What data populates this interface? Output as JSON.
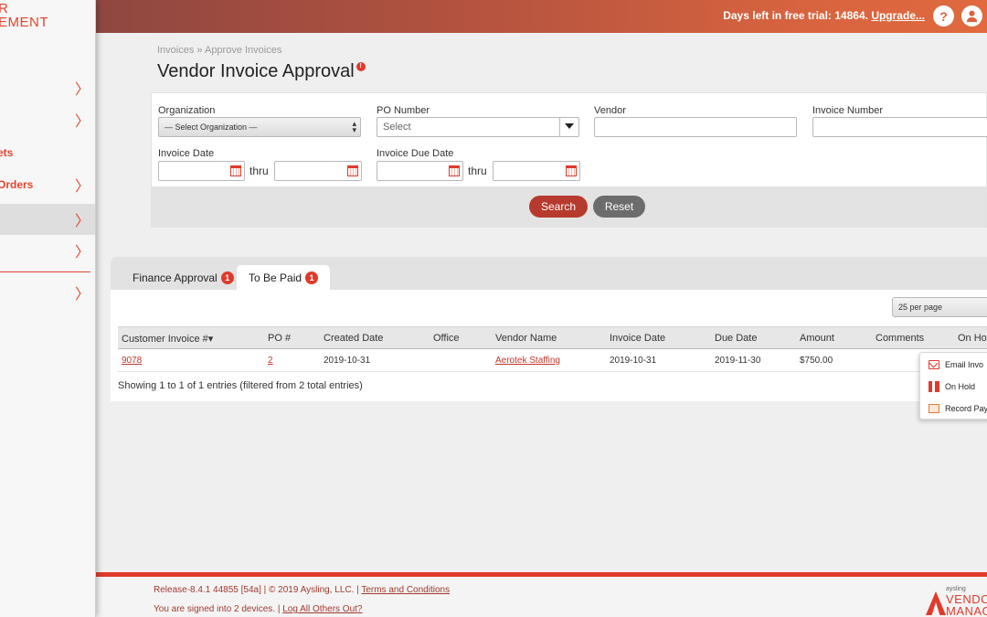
{
  "sidebar": {
    "logo_line1": "R",
    "logo_line2": "EMENT",
    "items": [
      {
        "label": "",
        "chevron": "〉"
      },
      {
        "label": "",
        "chevron": "〉"
      },
      {
        "label": "ets",
        "chevron": ""
      },
      {
        "label": "Orders",
        "chevron": "〉"
      },
      {
        "label": "",
        "chevron": "〉"
      },
      {
        "label": "",
        "chevron": "〉"
      },
      {
        "label": "",
        "chevron": "〉"
      }
    ]
  },
  "header": {
    "trial_text": "Days left in free trial: 14864.",
    "upgrade_label": "Upgrade...",
    "help_icon": "?",
    "user_icon": "user-icon"
  },
  "breadcrumb": "Invoices » Approve Invoices",
  "page_title": "Vendor Invoice Approval",
  "title_info_icon": "!",
  "filters": {
    "organization_label": "Organization",
    "organization_value": "— Select Organization —",
    "po_label": "PO Number",
    "po_placeholder": "Select",
    "vendor_label": "Vendor",
    "invoice_number_label": "Invoice Number",
    "invoice_date_label": "Invoice Date",
    "invoice_due_date_label": "Invoice Due Date",
    "thru_label": "thru",
    "search_label": "Search",
    "reset_label": "Reset"
  },
  "tabs": [
    {
      "label": "Finance Approval",
      "badge": "1"
    },
    {
      "label": "To Be Paid",
      "badge": "1"
    }
  ],
  "per_page": "25 per page",
  "table": {
    "headers": [
      "Customer Invoice #▾",
      "PO #",
      "Created Date",
      "Office",
      "Vendor Name",
      "Invoice Date",
      "Due Date",
      "Amount",
      "Comments",
      "On Hol"
    ],
    "rows": [
      {
        "invoice": "9078",
        "po": "2",
        "created": "2019-10-31",
        "office": "",
        "vendor": "Aerotek Staffing",
        "invoice_date": "2019-10-31",
        "due_date": "2019-11-30",
        "amount": "$750.00",
        "comments": ""
      }
    ],
    "showing": "Showing 1 to 1 of 1 entries (filtered from 2 total entries)"
  },
  "action_menu": [
    {
      "label": "Email Invo",
      "icon": "email-icon"
    },
    {
      "label": "On Hold",
      "icon": "pause-icon"
    },
    {
      "label": "Record Pay",
      "icon": "payment-icon"
    }
  ],
  "footer": {
    "release": "Release-8.4.1 44855 [54a] | © 2019 Aysling, LLC. |",
    "terms": "Terms and Conditions",
    "signed_in": "You are signed into 2 devices. |",
    "log_out": "Log All Others Out?",
    "logo_small": "aysling",
    "logo_line1": "VENDOR",
    "logo_line2": "MANAG"
  },
  "colors": {
    "accent": "#e03a2b",
    "header_start": "#8f4740",
    "header_end": "#e06a3e"
  }
}
